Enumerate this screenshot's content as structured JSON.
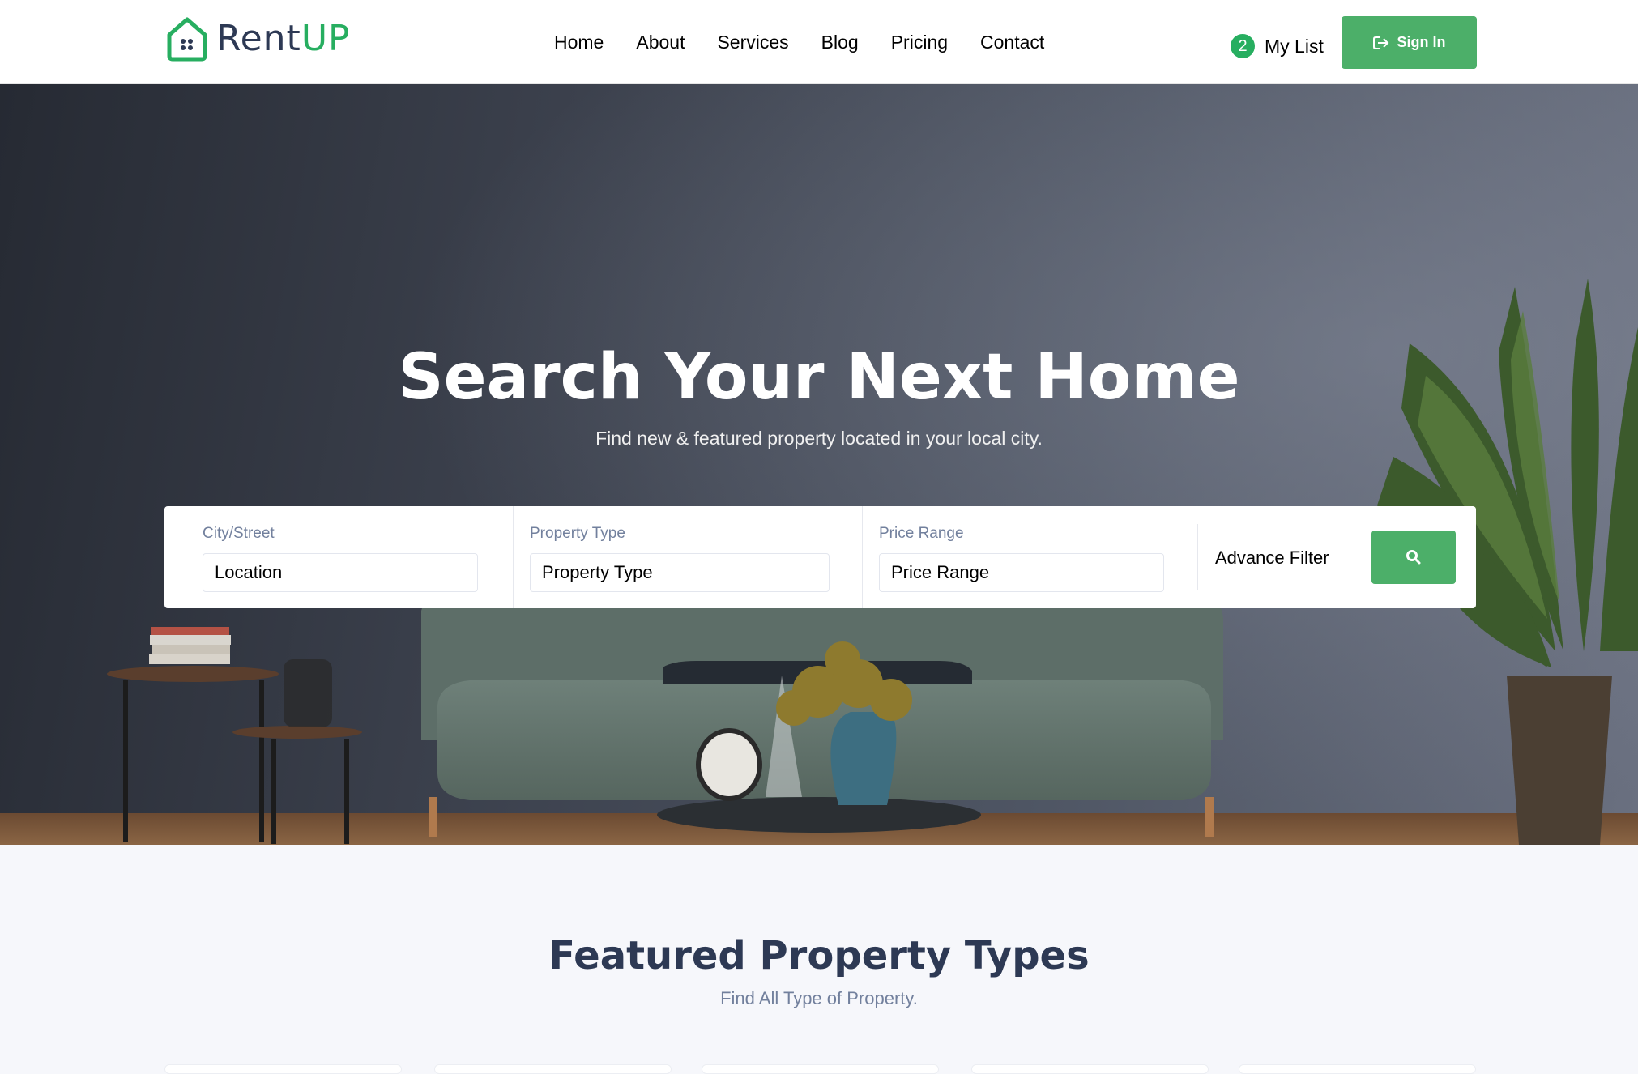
{
  "header": {
    "logo": {
      "name": "Rent",
      "accent": "UP"
    },
    "nav": [
      "Home",
      "About",
      "Services",
      "Blog",
      "Pricing",
      "Contact"
    ],
    "mylist": {
      "count": "2",
      "label": "My List"
    },
    "signin_label": "Sign In"
  },
  "hero": {
    "title": "Search Your Next Home",
    "subtitle": "Find new & featured property located in your local city."
  },
  "search": {
    "city": {
      "label": "City/Street",
      "value": "Location"
    },
    "type": {
      "label": "Property Type",
      "value": "Property Type"
    },
    "price": {
      "label": "Price Range",
      "value": "Price Range"
    },
    "advance_label": "Advance Filter"
  },
  "featured": {
    "title": "Featured Property Types",
    "subtitle": "Find All Type of Property."
  },
  "colors": {
    "accent": "#27ae60",
    "button": "#4caf69",
    "heading": "#2d3954",
    "muted": "#72809d"
  }
}
